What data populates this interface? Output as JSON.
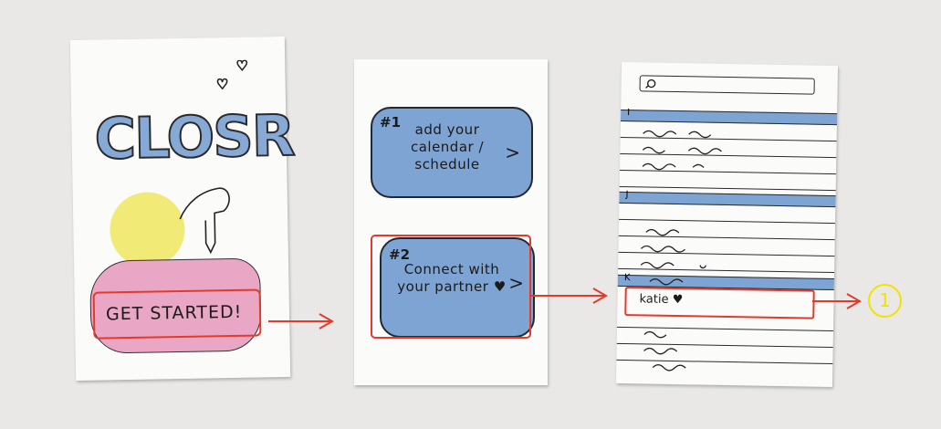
{
  "screen1": {
    "logo": "CLOSR",
    "get_started_label": "GET STARTED!"
  },
  "screen2": {
    "step1": {
      "number": "#1",
      "text": "add your calendar / schedule",
      "chevron": ">"
    },
    "step2": {
      "number": "#2",
      "text": "Connect with your partner ♥",
      "chevron": ">"
    }
  },
  "screen3": {
    "sections": [
      {
        "letter": "I"
      },
      {
        "letter": "J"
      },
      {
        "letter": "K"
      }
    ],
    "highlighted_contact": "katie ♥"
  },
  "annotation": {
    "marker": "1"
  },
  "colors": {
    "accent_blue": "#7ea4d3",
    "pink": "#e9a7c5",
    "yellow": "#f1ea77",
    "highlight_red": "#e33a2c",
    "marker_yellow": "#f2e200"
  }
}
